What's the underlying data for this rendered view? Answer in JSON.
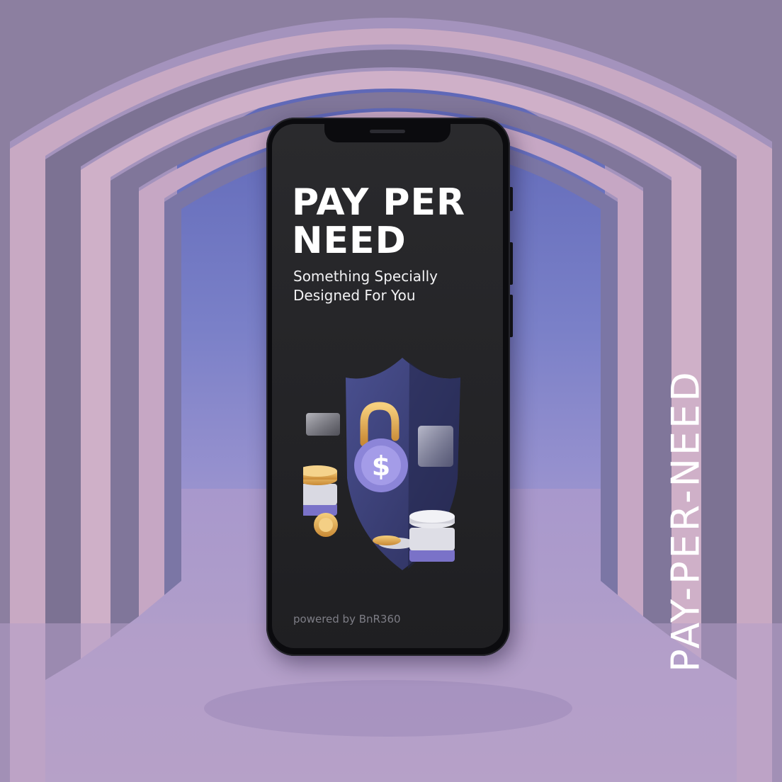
{
  "phone": {
    "headline": "PAY PER NEED",
    "subline": "Something Specially Designed For You",
    "powered_by": "powered by BnR360"
  },
  "side_label": "PAY-PER-NEED",
  "icons": [
    "shield-icon",
    "padlock-icon",
    "dollar-sign-icon",
    "coin-stack-icon"
  ],
  "colors": {
    "sky": "#6f78c0",
    "arch_light": "#c6a8c2",
    "arch_shadow": "#7d7390",
    "screen": "#242427",
    "shield": "#3f4579",
    "lock_body": "#8f87dc",
    "lock_shackle": "#e0a64c",
    "coin_gold": "#e9b45a"
  }
}
